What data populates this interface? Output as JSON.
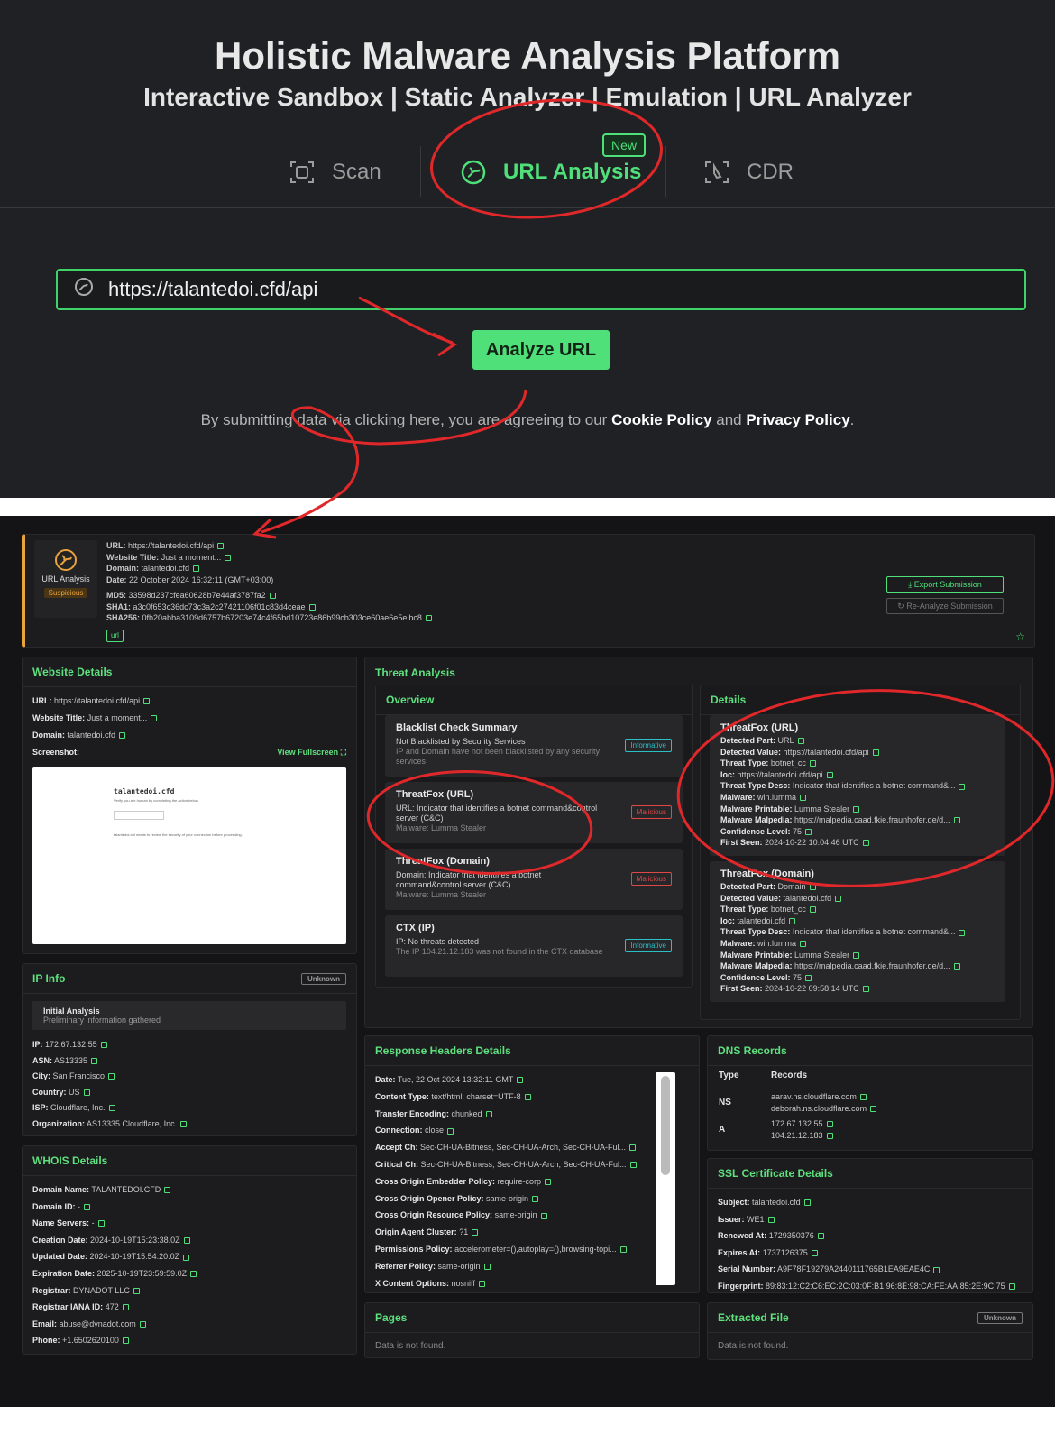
{
  "header": {
    "title": "Holistic Malware Analysis Platform",
    "subtitle": "Interactive Sandbox | Static Analyzer | Emulation | URL Analyzer"
  },
  "tabs": [
    {
      "label": "Scan",
      "icon": "scan-icon"
    },
    {
      "label": "URL Analysis",
      "icon": "url-analysis-icon",
      "badge": "New",
      "active": true
    },
    {
      "label": "CDR",
      "icon": "cdr-icon"
    }
  ],
  "url_input": {
    "value": "https://talantedoi.cfd/api"
  },
  "analyze_button": "Analyze URL",
  "terms": {
    "prefix": "By submitting data via clicking here, you are agreeing to our ",
    "cookie": "Cookie Policy",
    "and": " and ",
    "privacy": "Privacy Policy",
    "suffix": "."
  },
  "submission": {
    "icon_label": "URL Analysis",
    "verdict": "Suspicious",
    "url_label": "URL:",
    "url": "https://talantedoi.cfd/api",
    "title_label": "Website Title:",
    "title": "Just a moment...",
    "domain_label": "Domain:",
    "domain": "talantedoi.cfd",
    "date_label": "Date:",
    "date": "22 October 2024 16:32:11 (GMT+03:00)",
    "md5_label": "MD5:",
    "md5": "33598d237cfea60628b7e44af3787fa2",
    "sha1_label": "SHA1:",
    "sha1": "a3c0f653c36dc73c3a2c27421106f01c83d4ceae",
    "sha256_label": "SHA256:",
    "sha256": "0fb20abba3109d6757b67203e74c4f65bd10723e86b99cb303ce60ae6e5elbc8",
    "tag": "url",
    "export": "Export Submission",
    "reanalyze": "Re-Analyze Submission"
  },
  "website_details": {
    "title": "Website Details",
    "url_label": "URL:",
    "url": "https://talantedoi.cfd/api",
    "title_label": "Website Title:",
    "page_title": "Just a moment...",
    "domain_label": "Domain:",
    "domain": "talantedoi.cfd",
    "screenshot_label": "Screenshot:",
    "view_fullscreen": "View Fullscreen",
    "shot_heading": "talantedoi.cfd",
    "shot_line1": "Verify you are human by completing the action below.",
    "shot_line2": "talantedoi.cfd needs to review the security of your connection before proceeding."
  },
  "ip_info": {
    "title": "IP Info",
    "badge": "Unknown",
    "box_title": "Initial Analysis",
    "box_sub": "Preliminary information gathered",
    "rows": [
      {
        "k": "IP:",
        "v": "172.67.132.55"
      },
      {
        "k": "ASN:",
        "v": "AS13335"
      },
      {
        "k": "City:",
        "v": "San Francisco"
      },
      {
        "k": "Country:",
        "v": "US"
      },
      {
        "k": "ISP:",
        "v": "Cloudflare, Inc."
      },
      {
        "k": "Organization:",
        "v": "AS13335 Cloudflare, Inc."
      }
    ]
  },
  "whois": {
    "title": "WHOIS Details",
    "rows": [
      {
        "k": "Domain Name:",
        "v": "TALANTEDOI.CFD"
      },
      {
        "k": "Domain ID:",
        "v": "-"
      },
      {
        "k": "Name Servers:",
        "v": "-"
      },
      {
        "k": "Creation Date:",
        "v": "2024-10-19T15:23:38.0Z"
      },
      {
        "k": "Updated Date:",
        "v": "2024-10-19T15:54:20.0Z"
      },
      {
        "k": "Expiration Date:",
        "v": "2025-10-19T23:59:59.0Z"
      },
      {
        "k": "Registrar:",
        "v": "DYNADOT LLC"
      },
      {
        "k": "Registrar IANA ID:",
        "v": "472"
      },
      {
        "k": "Email:",
        "v": "abuse@dynadot.com"
      },
      {
        "k": "Phone:",
        "v": "+1.6502620100"
      }
    ]
  },
  "threat": {
    "title": "Threat Analysis",
    "overview_title": "Overview",
    "details_title": "Details",
    "cards": [
      {
        "t": "Blacklist Check Summary",
        "d": "Not Blacklisted by Security Services",
        "m": "IP and Domain have not been blacklisted by any security services",
        "badge": "Informative"
      },
      {
        "t": "ThreatFox (URL)",
        "d": "URL: Indicator that identifies a botnet command&control server (C&C)",
        "m": "Malware: Lumma Stealer",
        "badge": "Malicious"
      },
      {
        "t": "ThreatFox (Domain)",
        "d": "Domain: Indicator that identifies a botnet command&control server (C&C)",
        "m": "Malware: Lumma Stealer",
        "badge": "Malicious"
      },
      {
        "t": "CTX (IP)",
        "d": "IP: No threats detected",
        "m": "The IP 104.21.12.183 was not found in the CTX database",
        "badge": "Informative"
      }
    ],
    "details": [
      {
        "t": "ThreatFox (URL)",
        "rows": [
          {
            "k": "Detected Part:",
            "v": "URL"
          },
          {
            "k": "Detected Value:",
            "v": "https://talantedoi.cfd/api"
          },
          {
            "k": "Threat Type:",
            "v": "botnet_cc"
          },
          {
            "k": "Ioc:",
            "v": "https://talantedoi.cfd/api"
          },
          {
            "k": "Threat Type Desc:",
            "v": "Indicator that identifies a botnet command&..."
          },
          {
            "k": "Malware:",
            "v": "win.lumma"
          },
          {
            "k": "Malware Printable:",
            "v": "Lumma Stealer"
          },
          {
            "k": "Malware Malpedia:",
            "v": "https://malpedia.caad.fkie.fraunhofer.de/d..."
          },
          {
            "k": "Confidence Level:",
            "v": "75"
          },
          {
            "k": "First Seen:",
            "v": "2024-10-22 10:04:46 UTC"
          }
        ]
      },
      {
        "t": "ThreatFox (Domain)",
        "rows": [
          {
            "k": "Detected Part:",
            "v": "Domain"
          },
          {
            "k": "Detected Value:",
            "v": "talantedoi.cfd"
          },
          {
            "k": "Threat Type:",
            "v": "botnet_cc"
          },
          {
            "k": "Ioc:",
            "v": "talantedoi.cfd"
          },
          {
            "k": "Threat Type Desc:",
            "v": "Indicator that identifies a botnet command&..."
          },
          {
            "k": "Malware:",
            "v": "win.lumma"
          },
          {
            "k": "Malware Printable:",
            "v": "Lumma Stealer"
          },
          {
            "k": "Malware Malpedia:",
            "v": "https://malpedia.caad.fkie.fraunhofer.de/d..."
          },
          {
            "k": "Confidence Level:",
            "v": "75"
          },
          {
            "k": "First Seen:",
            "v": "2024-10-22 09:58:14 UTC"
          }
        ]
      }
    ]
  },
  "response_headers": {
    "title": "Response Headers Details",
    "rows": [
      {
        "k": "Date:",
        "v": "Tue, 22 Oct 2024 13:32:11 GMT"
      },
      {
        "k": "Content Type:",
        "v": "text/html; charset=UTF-8"
      },
      {
        "k": "Transfer Encoding:",
        "v": "chunked"
      },
      {
        "k": "Connection:",
        "v": "close"
      },
      {
        "k": "Accept Ch:",
        "v": "Sec-CH-UA-Bitness, Sec-CH-UA-Arch, Sec-CH-UA-Ful..."
      },
      {
        "k": "Critical Ch:",
        "v": "Sec-CH-UA-Bitness, Sec-CH-UA-Arch, Sec-CH-UA-Ful..."
      },
      {
        "k": "Cross Origin Embedder Policy:",
        "v": "require-corp"
      },
      {
        "k": "Cross Origin Opener Policy:",
        "v": "same-origin"
      },
      {
        "k": "Cross Origin Resource Policy:",
        "v": "same-origin"
      },
      {
        "k": "Origin Agent Cluster:",
        "v": "?1"
      },
      {
        "k": "Permissions Policy:",
        "v": "accelerometer=(),autoplay=(),browsing-topi..."
      },
      {
        "k": "Referrer Policy:",
        "v": "same-origin"
      },
      {
        "k": "X Content Options:",
        "v": "nosniff"
      }
    ]
  },
  "dns": {
    "title": "DNS Records",
    "type_header": "Type",
    "records_header": "Records",
    "rows": [
      {
        "type": "NS",
        "records": [
          "aarav.ns.cloudflare.com",
          "deborah.ns.cloudflare.com"
        ]
      },
      {
        "type": "A",
        "records": [
          "172.67.132.55",
          "104.21.12.183"
        ]
      }
    ]
  },
  "ssl": {
    "title": "SSL Certificate Details",
    "rows": [
      {
        "k": "Subject:",
        "v": "talantedoi.cfd"
      },
      {
        "k": "Issuer:",
        "v": "WE1"
      },
      {
        "k": "Renewed At:",
        "v": "1729350376"
      },
      {
        "k": "Expires At:",
        "v": "1737126375"
      },
      {
        "k": "Serial Number:",
        "v": "A9F78F19279A2440111765B1EA9EAE4C"
      },
      {
        "k": "Fingerprint:",
        "v": "89:83:12:C2:C6:EC:2C:03:0F:B1:96:8E:98:CA:FE:AA:85:2E:9C:75"
      }
    ]
  },
  "pages": {
    "title": "Pages",
    "empty": "Data is not found."
  },
  "extracted": {
    "title": "Extracted File",
    "badge": "Unknown",
    "empty": "Data is not found."
  },
  "colors": {
    "accent": "#4fe07a",
    "annotation": "#e0282a",
    "malicious": "#e04848",
    "informative": "#2bbfc6",
    "suspicious": "#e8a33c"
  }
}
